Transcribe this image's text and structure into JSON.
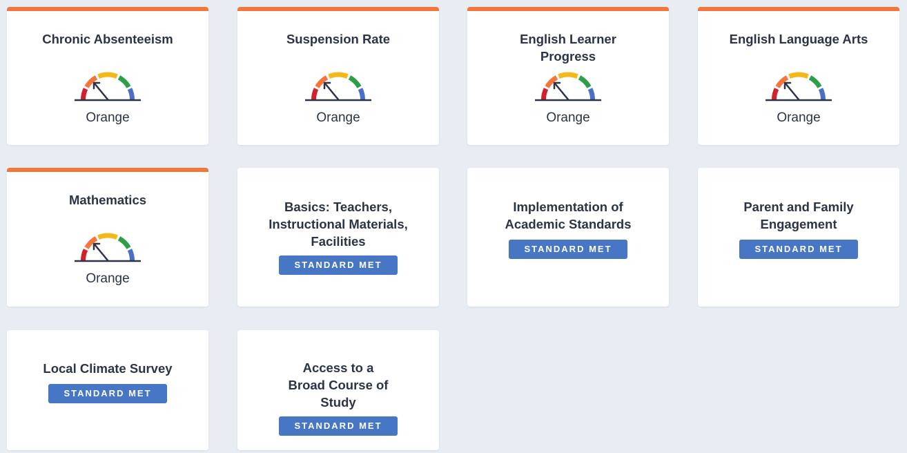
{
  "colors": {
    "page_background": "#e8ecf3",
    "card_top_border": "#f4763a",
    "badge_background": "#4777c4",
    "gauge_segments": [
      "#d3212c",
      "#f4763a",
      "#f4b919",
      "#2d9f48",
      "#4a6fc6"
    ],
    "gauge_needle": "#2b3447"
  },
  "gauge_cards": [
    {
      "title": "Chronic Absenteeism",
      "status": "Orange",
      "status_level": "orange"
    },
    {
      "title": "Suspension Rate",
      "status": "Orange",
      "status_level": "orange"
    },
    {
      "title": "English Learner Progress",
      "status": "Orange",
      "status_level": "orange"
    },
    {
      "title": "English Language Arts",
      "status": "Orange",
      "status_level": "orange"
    },
    {
      "title": "Mathematics",
      "status": "Orange",
      "status_level": "orange"
    }
  ],
  "standard_cards": [
    {
      "title": "Basics: Teachers, Instructional Materials, Facilities",
      "badge": "STANDARD MET"
    },
    {
      "title": "Implementation of Academic Standards",
      "badge": "STANDARD MET"
    },
    {
      "title": "Parent and Family Engagement",
      "badge": "STANDARD MET"
    },
    {
      "title": "Local Climate Survey",
      "badge": "STANDARD MET"
    },
    {
      "title": "Access to a Broad Course of Study",
      "badge": "STANDARD MET"
    }
  ]
}
